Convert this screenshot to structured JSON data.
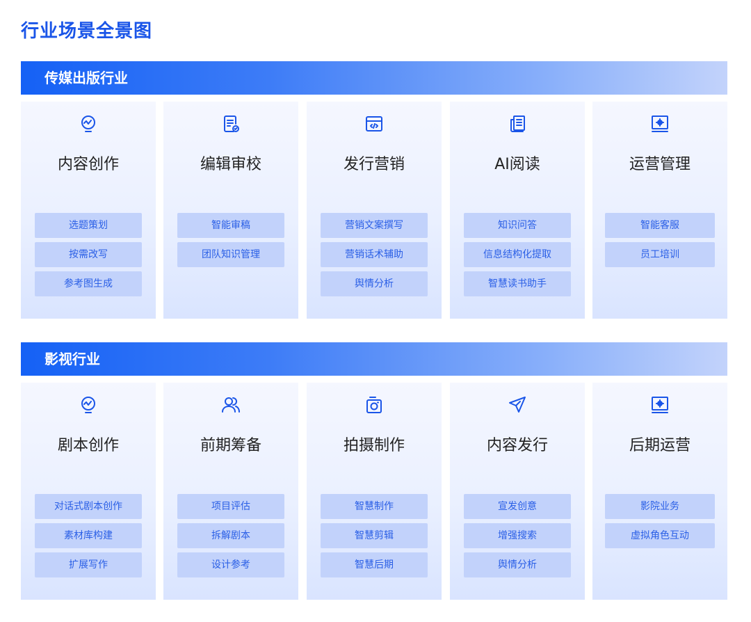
{
  "page_title": "行业场景全景图",
  "sections": [
    {
      "title": "传媒出版行业",
      "cards": [
        {
          "icon": "bulb-chart-icon",
          "title": "内容创作",
          "tags": [
            "选题策划",
            "按需改写",
            "参考图生成"
          ]
        },
        {
          "icon": "document-check-icon",
          "title": "编辑审校",
          "tags": [
            "智能审稿",
            "团队知识管理"
          ]
        },
        {
          "icon": "code-window-icon",
          "title": "发行营销",
          "tags": [
            "营销文案撰写",
            "营销话术辅助",
            "舆情分析"
          ]
        },
        {
          "icon": "reader-icon",
          "title": "AI阅读",
          "tags": [
            "知识问答",
            "信息结构化提取",
            "智慧读书助手"
          ]
        },
        {
          "icon": "monitor-gear-icon",
          "title": "运营管理",
          "tags": [
            "智能客服",
            "员工培训"
          ]
        }
      ]
    },
    {
      "title": "影视行业",
      "cards": [
        {
          "icon": "bulb-chart-icon",
          "title": "剧本创作",
          "tags": [
            "对话式剧本创作",
            "素材库构建",
            "扩展写作"
          ]
        },
        {
          "icon": "users-icon",
          "title": "前期筹备",
          "tags": [
            "项目评估",
            "拆解剧本",
            "设计参考"
          ]
        },
        {
          "icon": "camera-icon",
          "title": "拍摄制作",
          "tags": [
            "智慧制作",
            "智慧剪辑",
            "智慧后期"
          ]
        },
        {
          "icon": "paper-plane-icon",
          "title": "内容发行",
          "tags": [
            "宣发创意",
            "增强搜索",
            "舆情分析"
          ]
        },
        {
          "icon": "monitor-gear-icon",
          "title": "后期运营",
          "tags": [
            "影院业务",
            "虚拟角色互动"
          ]
        }
      ]
    }
  ]
}
